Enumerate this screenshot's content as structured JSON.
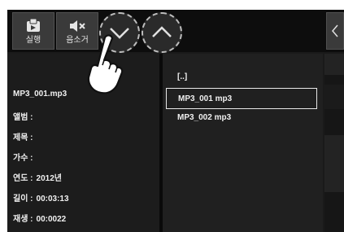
{
  "toolbar": {
    "run": {
      "label": "실행",
      "icon": "run-icon"
    },
    "mute": {
      "label": "음소거",
      "icon": "mute-icon"
    },
    "scroll_down": {
      "icon": "chevron-down-icon"
    },
    "scroll_up": {
      "icon": "chevron-up-icon"
    },
    "side": {
      "icon": "chevron-left-icon"
    }
  },
  "info": {
    "filename": "MP3_001.mp3",
    "album": {
      "key": "앨범 :",
      "value": ""
    },
    "title": {
      "key": "제목 :",
      "value": ""
    },
    "artist": {
      "key": "가수 :",
      "value": ""
    },
    "year": {
      "key": "연도 :",
      "value": "2012년"
    },
    "length": {
      "key": "길이 :",
      "value": "00:03:13"
    },
    "played": {
      "key": "재생 :",
      "value": "00:0022"
    }
  },
  "files": [
    {
      "label": "[..]",
      "selected": false
    },
    {
      "label": "MP3_001 mp3",
      "selected": true
    },
    {
      "label": "MP3_002 mp3",
      "selected": false
    }
  ],
  "colors": {
    "background": "#1a1a1a",
    "selection_border": "#e8e8e8"
  }
}
